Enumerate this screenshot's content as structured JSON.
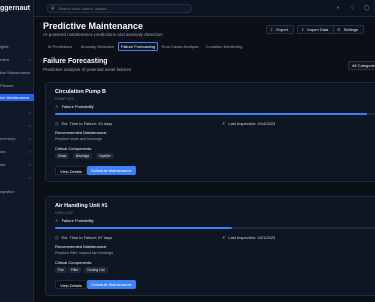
{
  "app": {
    "brand": "ggernaut"
  },
  "sidebar": {
    "items": [
      {
        "label": "",
        "chevron": ""
      },
      {
        "label": "ights",
        "chevron": ""
      },
      {
        "label": "rders",
        "chevron": ">"
      },
      {
        "label": "tive Maintenance",
        "chevron": ""
      },
      {
        "label": "Planner",
        "chevron": ""
      },
      {
        "label": "ive Maintenance",
        "chevron": ""
      },
      {
        "label": "",
        "chevron": ">"
      },
      {
        "label": "",
        "chevron": ">"
      },
      {
        "label": "nventory",
        "chevron": ">"
      },
      {
        "label": "ors",
        "chevron": ">"
      },
      {
        "label": "ets",
        "chevron": ">"
      },
      {
        "label": "",
        "chevron": ">"
      },
      {
        "label": "egration",
        "chevron": ""
      },
      {
        "label": "",
        "chevron": ""
      },
      {
        "label": "",
        "chevron": ""
      }
    ]
  },
  "topbar": {
    "search_placeholder": "Search work orders, assets...",
    "icons": [
      "theme-icon",
      "notification-icon",
      "user-icon"
    ]
  },
  "header": {
    "title": "Predictive Maintenance",
    "subtitle": "AI-powered maintenance predictions and anomaly detection",
    "export_label": "Export",
    "import_label": "Import Data",
    "settings_label": "Settings"
  },
  "tabs": [
    "AI Predictions",
    "Anomaly Detection",
    "Failure Forecasting",
    "Root Cause Analysis",
    "Condition Monitoring"
  ],
  "active_tab": "Failure Forecasting",
  "section": {
    "title": "Failure Forecasting",
    "subtitle": "Predictive analysis of potential asset failures",
    "filter_label": "All Categories"
  },
  "cards": [
    {
      "name": "Circulation Pump B",
      "id": "PUMP-023",
      "prob_label": "Failure Probability",
      "probability": 0.97,
      "pct_text": "",
      "time_to_failure": "Est. Time to Failure: 43 days",
      "last_inspection": "Last Inspection: 4/14/2023",
      "rec_label": "Recommended Maintenance:",
      "rec_text": "Replace seals and bearings",
      "comp_label": "Critical Components:",
      "components": [
        "Seals",
        "Bearings",
        "Impeller"
      ],
      "view_label": "View Details",
      "schedule_label": "Schedule Maintenance"
    },
    {
      "name": "Air Handling Unit #1",
      "id": "HVAC-002",
      "prob_label": "Failure Probability",
      "probability": 0.55,
      "pct_text": "",
      "time_to_failure": "Est. Time to Failure: 67 days",
      "last_inspection": "Last Inspection: 4/21/2023",
      "rec_label": "Recommended Maintenance:",
      "rec_text": "Replace filter, inspect fan bearings",
      "comp_label": "Critical Components:",
      "components": [
        "Fan",
        "Filter",
        "Cooling Coil"
      ],
      "view_label": "View Details",
      "schedule_label": "Schedule Maintenance"
    }
  ],
  "colors": {
    "accent": "#3b82f6",
    "warning": "#f59e0b",
    "background": "#0b0f17"
  }
}
